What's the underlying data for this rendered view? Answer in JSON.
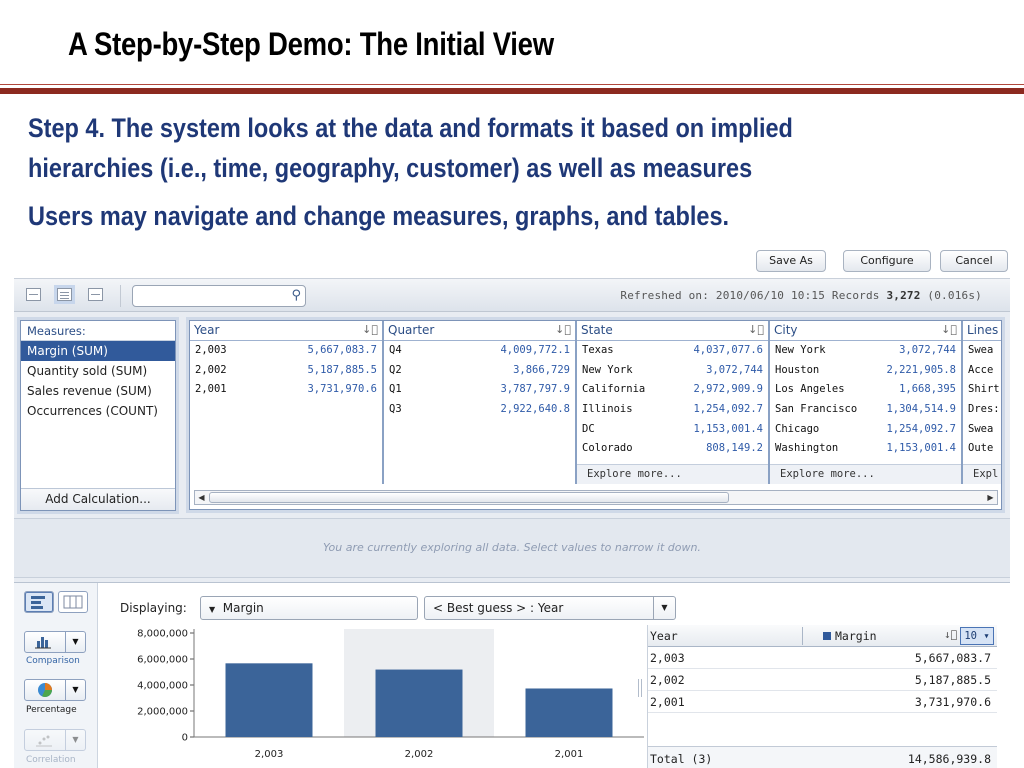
{
  "slide": {
    "title": "A Step-by-Step Demo: The Initial View",
    "bullet1": "Step 4. The system looks at the data and formats it based on implied",
    "bullet2": "hierarchies (i.e., time, geography, customer) as well as measures",
    "bullet3": "Users may navigate and change measures, graphs, and tables."
  },
  "topbar": {
    "save_as": "Save As",
    "configure": "Configure",
    "cancel": "Cancel"
  },
  "toolbar": {
    "search_placeholder": "",
    "refreshed_label": "Refreshed on: 2010/06/10 10:15 Records ",
    "records": "3,272",
    "duration": " (0.016s)"
  },
  "measures": {
    "header": "Measures:",
    "items": [
      "Margin (SUM)",
      "Quantity sold (SUM)",
      "Sales revenue (SUM)",
      "Occurrences (COUNT)"
    ],
    "add_calculation": "Add Calculation..."
  },
  "facets": {
    "year": {
      "header": "Year",
      "rows": [
        [
          "2,003",
          "5,667,083.7"
        ],
        [
          "2,002",
          "5,187,885.5"
        ],
        [
          "2,001",
          "3,731,970.6"
        ]
      ]
    },
    "quarter": {
      "header": "Quarter",
      "rows": [
        [
          "Q4",
          "4,009,772.1"
        ],
        [
          "Q2",
          "3,866,729"
        ],
        [
          "Q1",
          "3,787,797.9"
        ],
        [
          "Q3",
          "2,922,640.8"
        ]
      ]
    },
    "state": {
      "header": "State",
      "rows": [
        [
          "Texas",
          "4,037,077.6"
        ],
        [
          "New York",
          "3,072,744"
        ],
        [
          "California",
          "2,972,909.9"
        ],
        [
          "Illinois",
          "1,254,092.7"
        ],
        [
          "DC",
          "1,153,001.4"
        ],
        [
          "Colorado",
          "808,149.2"
        ]
      ],
      "more": "Explore more..."
    },
    "city": {
      "header": "City",
      "rows": [
        [
          "New York",
          "3,072,744"
        ],
        [
          "Houston",
          "2,221,905.8"
        ],
        [
          "Los Angeles",
          "1,668,395"
        ],
        [
          "San Francisco",
          "1,304,514.9"
        ],
        [
          "Chicago",
          "1,254,092.7"
        ],
        [
          "Washington",
          "1,153,001.4"
        ]
      ],
      "more": "Explore more..."
    },
    "lines": {
      "header": "Lines",
      "rows": [
        "Swea",
        "Acce",
        "Shirt",
        "Dres:",
        "Swea",
        "Oute"
      ],
      "more": "Expl"
    }
  },
  "info_message": "You are currently exploring all data. Select values to narrow it down.",
  "visualization": {
    "displaying_label": "Displaying:",
    "measure_select": "Margin",
    "dimension_select": "< Best guess > : Year",
    "tools": {
      "comparison": "Comparison",
      "percentage": "Percentage",
      "correlation": "Correlation"
    }
  },
  "chart_data": {
    "type": "bar",
    "categories": [
      "2,003",
      "2,002",
      "2,001"
    ],
    "values": [
      5667083.7,
      5187885.5,
      3731970.6
    ],
    "ytick_labels": [
      "8,000,000",
      "6,000,000",
      "4,000,000",
      "2,000,000",
      "0"
    ],
    "ylim": [
      0,
      8000000
    ],
    "bar_color": "#3b6499",
    "highlight_color": "#eceef1"
  },
  "table": {
    "col_year": "Year",
    "col_margin": "Margin",
    "top_n": "10",
    "rows": [
      [
        "2,003",
        "5,667,083.7"
      ],
      [
        "2,002",
        "5,187,885.5"
      ],
      [
        "2,001",
        "3,731,970.6"
      ]
    ],
    "total_label": "Total (3)",
    "total_value": "14,586,939.8"
  }
}
